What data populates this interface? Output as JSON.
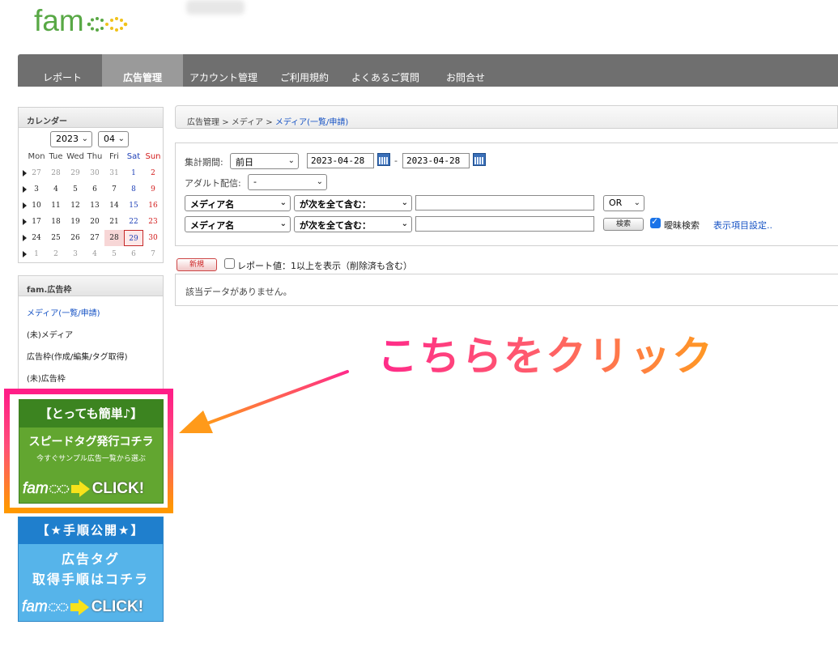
{
  "app": {
    "logo_text": "fam"
  },
  "nav": {
    "items": [
      {
        "label": "レポート"
      },
      {
        "label": "広告管理"
      },
      {
        "label": "アカウント管理"
      },
      {
        "label": "ご利用規約"
      },
      {
        "label": "よくあるご質問"
      },
      {
        "label": "お問合せ"
      }
    ],
    "active": "広告管理"
  },
  "calendar": {
    "title": "カレンダー",
    "year": "2023",
    "month": "04",
    "weekdays": [
      "Mon",
      "Tue",
      "Wed",
      "Thu",
      "Fri",
      "Sat",
      "Sun"
    ],
    "weeks": [
      [
        "27",
        "28",
        "29",
        "30",
        "31",
        "1",
        "2"
      ],
      [
        "3",
        "4",
        "5",
        "6",
        "7",
        "8",
        "9"
      ],
      [
        "10",
        "11",
        "12",
        "13",
        "14",
        "15",
        "16"
      ],
      [
        "17",
        "18",
        "19",
        "20",
        "21",
        "22",
        "23"
      ],
      [
        "24",
        "25",
        "26",
        "27",
        "28",
        "29",
        "30"
      ],
      [
        "1",
        "2",
        "3",
        "4",
        "5",
        "6",
        "7"
      ]
    ],
    "selected": "28",
    "today": "29"
  },
  "left_menu": {
    "title": "fam.広告枠",
    "items": [
      {
        "label": "メディア(一覧/申請)",
        "active": true
      },
      {
        "label": "(未)メディア"
      },
      {
        "label": "広告枠(作成/編集/タグ取得)"
      },
      {
        "label": "(未)広告枠"
      }
    ]
  },
  "banners": {
    "speed": {
      "title": "【とっても簡単♪】",
      "line1": "スピードタグ発行コチラ",
      "line2": "今すぐサンプル広告一覧から選ぶ",
      "logo": "fam",
      "cta": "CLICK!"
    },
    "guide": {
      "title": "【★手順公開★】",
      "line1": "広告タグ",
      "line2": "取得手順はコチラ",
      "logo": "fam",
      "cta": "CLICK!"
    }
  },
  "breadcrumb": {
    "items": [
      "広告管理",
      "メディア",
      "メディア(一覧/申請)"
    ],
    "separator": ">"
  },
  "filter": {
    "period_label": "集計期間:",
    "period_value": "前日",
    "date_from": "2023-04-28",
    "date_to": "2023-04-28",
    "date_sep": "-",
    "adult_label": "アダルト配信:",
    "adult_value": "-",
    "row1": {
      "field": "メディア名",
      "op": "が次を全て含む：",
      "value": "",
      "logic": "OR"
    },
    "row2": {
      "field": "メディア名",
      "op": "が次を全て含む：",
      "value": ""
    },
    "search_button": "検索",
    "fuzzy_label": "曖昧検索",
    "fuzzy_checked": true,
    "display_settings": "表示項目設定.."
  },
  "actions": {
    "new_button": "新規",
    "report_label": "レポート値：1以上を表示（削除済も含む）",
    "report_checked": false
  },
  "results": {
    "empty_message": "該当データがありません。"
  },
  "annotation": {
    "text": "こちらをクリック"
  }
}
